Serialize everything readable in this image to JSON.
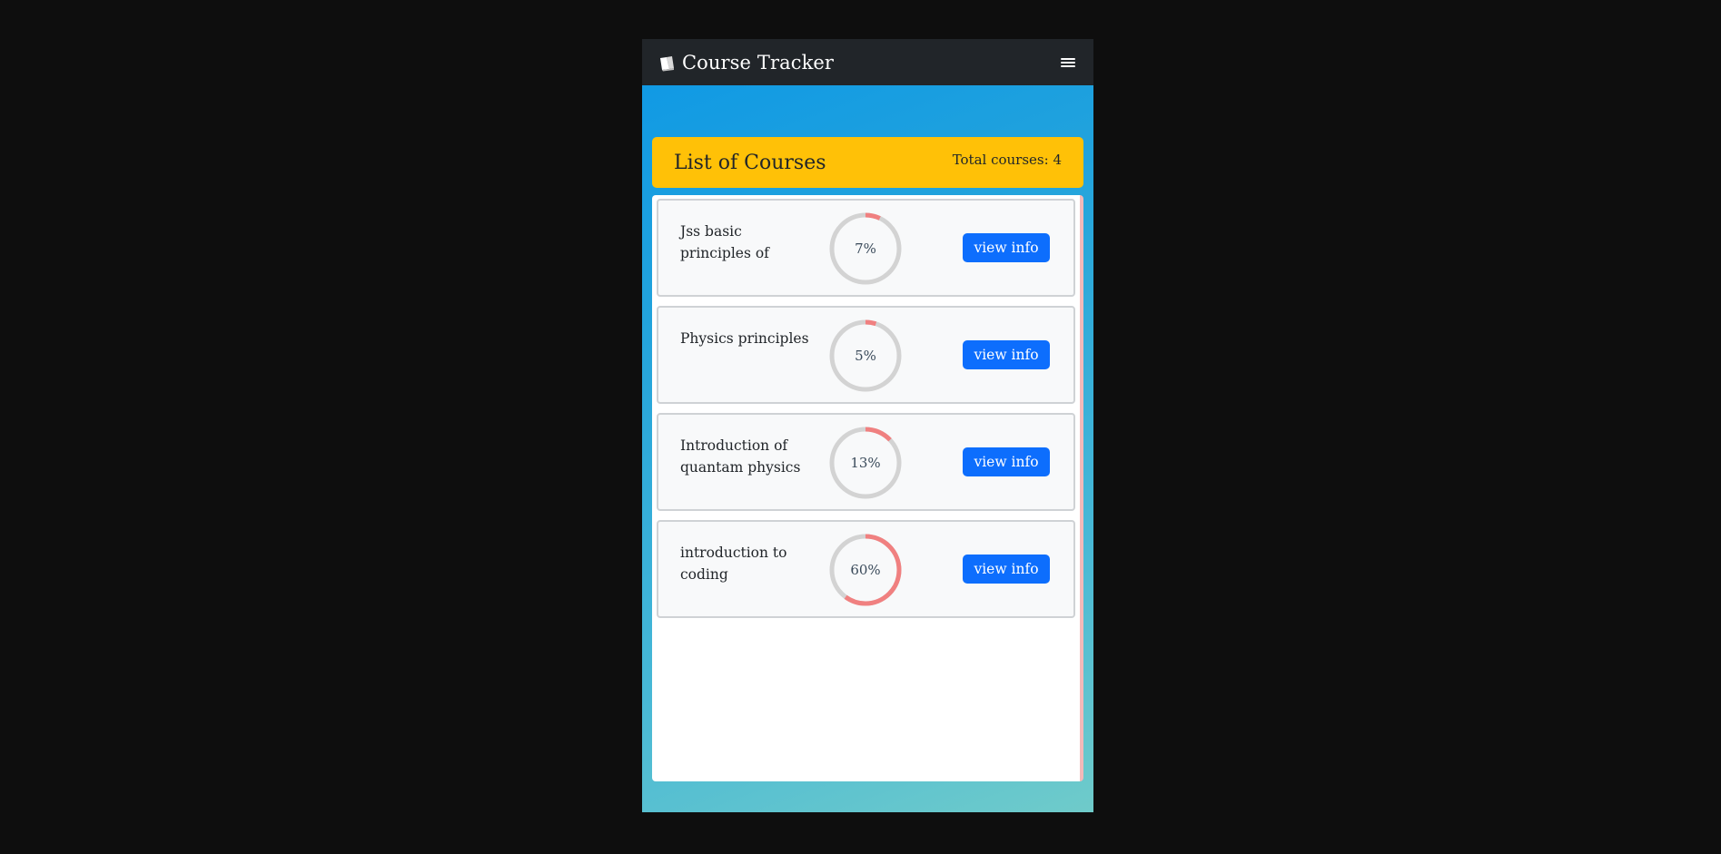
{
  "navbar": {
    "brand_icon": "book-icon",
    "title": "Course Tracker",
    "menu_icon": "hamburger-icon"
  },
  "header": {
    "title": "List of Courses",
    "total_label": "Total courses: 4"
  },
  "courses": [
    {
      "name": "Jss basic principles of",
      "progress": 7,
      "progress_label": "7%",
      "button_label": "view info"
    },
    {
      "name": "Physics principles",
      "progress": 5,
      "progress_label": "5%",
      "button_label": "view info"
    },
    {
      "name": "Introduction of quantam physics",
      "progress": 13,
      "progress_label": "13%",
      "button_label": "view info"
    },
    {
      "name": "introduction to coding",
      "progress": 60,
      "progress_label": "60%",
      "button_label": "view info"
    }
  ],
  "colors": {
    "navbar_bg": "#212529",
    "header_bg": "#ffc107",
    "button_bg": "#0d6efd",
    "progress_fill": "#f08080",
    "progress_track": "#d3d3d3"
  }
}
